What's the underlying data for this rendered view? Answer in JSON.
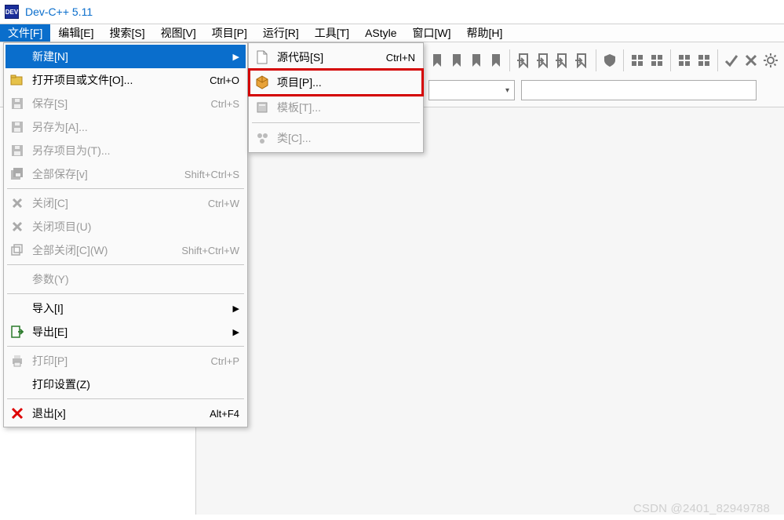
{
  "app": {
    "icon_text": "DEV",
    "title": "Dev-C++ 5.11"
  },
  "menubar": {
    "items": [
      {
        "label": "文件[F]",
        "active": true
      },
      {
        "label": "编辑[E]"
      },
      {
        "label": "搜索[S]"
      },
      {
        "label": "视图[V]"
      },
      {
        "label": "项目[P]"
      },
      {
        "label": "运行[R]"
      },
      {
        "label": "工具[T]"
      },
      {
        "label": "AStyle"
      },
      {
        "label": "窗口[W]"
      },
      {
        "label": "帮助[H]"
      }
    ]
  },
  "file_menu": {
    "items": [
      {
        "kind": "item",
        "icon": "blank",
        "label": "新建[N]",
        "arrow": true,
        "highlight": true
      },
      {
        "kind": "item",
        "icon": "open",
        "label": "打开项目或文件[O]...",
        "shortcut": "Ctrl+O"
      },
      {
        "kind": "item",
        "icon": "save-gray",
        "label": "保存[S]",
        "shortcut": "Ctrl+S",
        "disabled": true
      },
      {
        "kind": "item",
        "icon": "save-gray",
        "label": "另存为[A]...",
        "disabled": true
      },
      {
        "kind": "item",
        "icon": "save-gray",
        "label": "另存项目为(T)...",
        "disabled": true
      },
      {
        "kind": "item",
        "icon": "saveall-gray",
        "label": "全部保存[v]",
        "shortcut": "Shift+Ctrl+S",
        "disabled": true
      },
      {
        "kind": "sep"
      },
      {
        "kind": "item",
        "icon": "close-gray",
        "label": "关闭[C]",
        "shortcut": "Ctrl+W",
        "disabled": true
      },
      {
        "kind": "item",
        "icon": "close-gray",
        "label": "关闭项目(U)",
        "disabled": true
      },
      {
        "kind": "item",
        "icon": "closeall-gray",
        "label": "全部关闭[C](W)",
        "shortcut": "Shift+Ctrl+W",
        "disabled": true
      },
      {
        "kind": "sep"
      },
      {
        "kind": "item",
        "icon": "blank",
        "label": "参数(Y)",
        "disabled": true
      },
      {
        "kind": "sep"
      },
      {
        "kind": "item",
        "icon": "blank",
        "label": "导入[I]",
        "arrow": true
      },
      {
        "kind": "item",
        "icon": "export",
        "label": "导出[E]",
        "arrow": true
      },
      {
        "kind": "sep"
      },
      {
        "kind": "item",
        "icon": "print-gray",
        "label": "打印[P]",
        "shortcut": "Ctrl+P",
        "disabled": true
      },
      {
        "kind": "item",
        "icon": "blank",
        "label": "打印设置(Z)"
      },
      {
        "kind": "sep"
      },
      {
        "kind": "item",
        "icon": "exit",
        "label": "退出[x]",
        "shortcut": "Alt+F4"
      }
    ]
  },
  "new_submenu": {
    "items": [
      {
        "icon": "file",
        "label": "源代码[S]",
        "shortcut": "Ctrl+N"
      },
      {
        "icon": "project",
        "label": "项目[P]...",
        "redbox": true
      },
      {
        "icon": "template-gray",
        "label": "模板[T]...",
        "disabled": true
      },
      {
        "kind": "sep"
      },
      {
        "icon": "class-gray",
        "label": "类[C]...",
        "disabled": true
      }
    ]
  },
  "toolbar": {
    "icons_row1": [
      "bookmark",
      "bookmark",
      "bookmark",
      "bookmark",
      "sep",
      "goto",
      "goto",
      "goto",
      "goto",
      "sep",
      "shield",
      "sep",
      "grid",
      "grid",
      "sep",
      "grid",
      "grid",
      "sep",
      "check",
      "cross",
      "gear"
    ],
    "combo1": "",
    "combo2": ""
  },
  "watermark": "CSDN @2401_82949788"
}
